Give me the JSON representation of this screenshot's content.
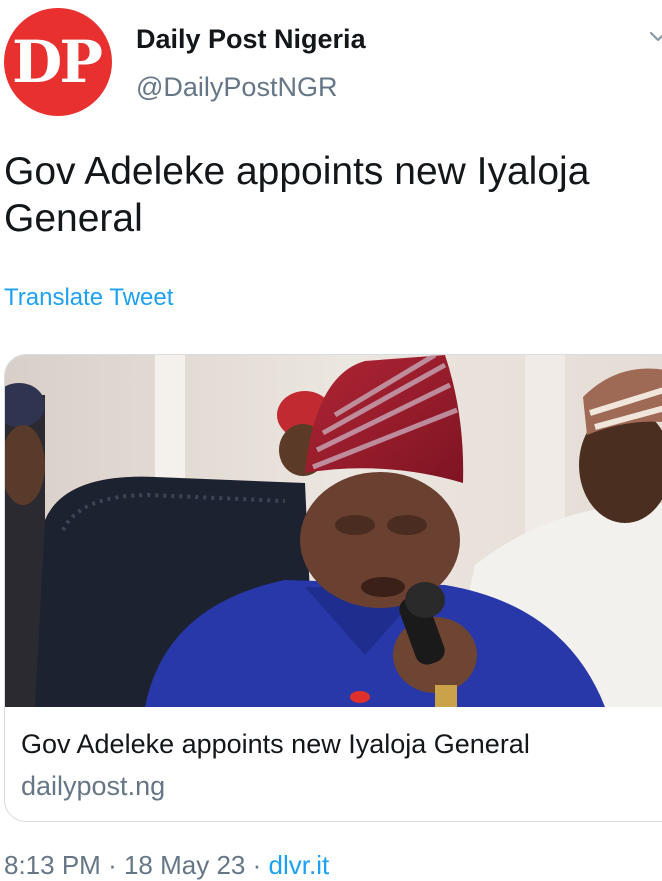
{
  "author": {
    "avatar_text": "DP",
    "display_name": "Daily Post Nigeria",
    "handle": "@DailyPostNGR"
  },
  "tweet": {
    "text": "Gov Adeleke appoints new Iyaloja General",
    "translate_label": "Translate Tweet"
  },
  "link_card": {
    "title": "Gov Adeleke appoints new Iyaloja General",
    "domain": "dailypost.ng"
  },
  "meta": {
    "time": "8:13 PM",
    "separator": "·",
    "date": "18 May 23",
    "source": "dlvr.it"
  },
  "colors": {
    "avatar_bg": "#e8302f",
    "link": "#1da1f2",
    "secondary_text": "#657786"
  }
}
